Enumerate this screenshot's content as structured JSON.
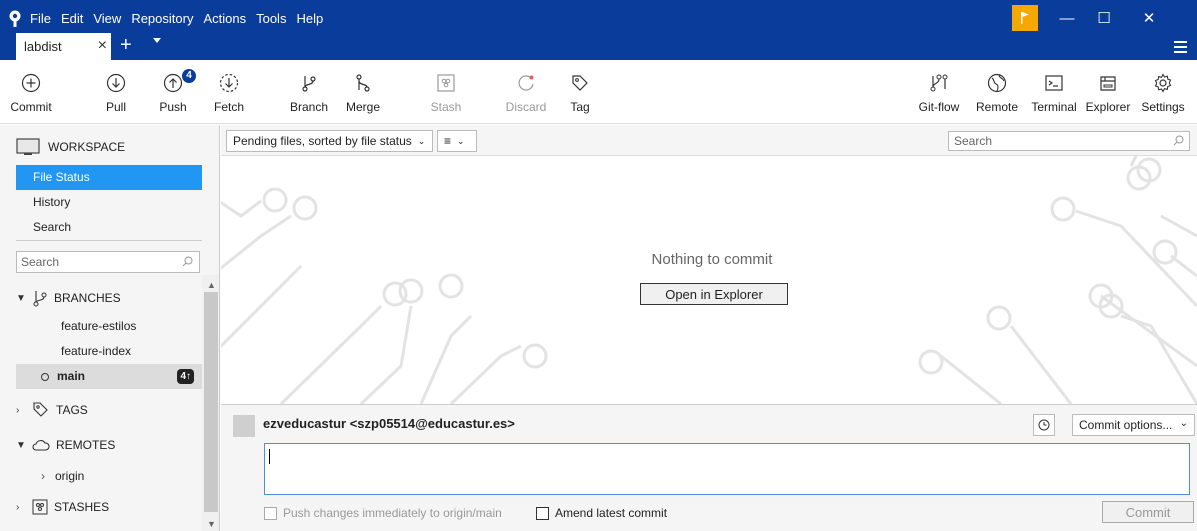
{
  "menu": [
    "File",
    "Edit",
    "View",
    "Repository",
    "Actions",
    "Tools",
    "Help"
  ],
  "tab": {
    "label": "labdist",
    "close": "×",
    "add": "+"
  },
  "window": {
    "minimize": "—",
    "maximize": "☐",
    "close": "✕"
  },
  "toolbar": {
    "commit": "Commit",
    "pull": "Pull",
    "push": "Push",
    "push_badge": "4",
    "fetch": "Fetch",
    "branch": "Branch",
    "merge": "Merge",
    "stash": "Stash",
    "discard": "Discard",
    "tag": "Tag",
    "gitflow": "Git-flow",
    "remote": "Remote",
    "terminal": "Terminal",
    "explorer": "Explorer",
    "settings": "Settings"
  },
  "sidebar": {
    "workspace": "WORKSPACE",
    "items": [
      "File Status",
      "History",
      "Search"
    ],
    "search_placeholder": "Search",
    "branches_header": "BRANCHES",
    "branches": [
      "feature-estilos",
      "feature-index"
    ],
    "current_branch": "main",
    "current_ahead": "4↑",
    "tags_header": "TAGS",
    "remotes_header": "REMOTES",
    "remotes": [
      "origin"
    ],
    "stashes_header": "STASHES"
  },
  "main": {
    "sort_dropdown": "Pending files, sorted by file status",
    "view_dropdown": "≡",
    "search_placeholder": "Search",
    "empty_message": "Nothing to commit",
    "open_explorer": "Open in Explorer"
  },
  "commit": {
    "author": "ezveducastur <szp05514@educastur.es>",
    "options": "Commit options...",
    "push_immediately": "Push changes immediately to origin/main",
    "amend": "Amend latest commit",
    "button": "Commit"
  }
}
